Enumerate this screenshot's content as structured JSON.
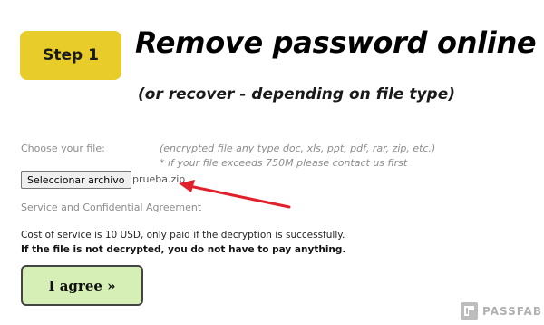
{
  "step": {
    "label": "Step 1"
  },
  "header": {
    "title": "Remove password online",
    "subtitle": "(or recover - depending on file type)"
  },
  "file_section": {
    "choose_label": "Choose your file:",
    "hint_types": "(encrypted file any type doc, xls, ppt, pdf, rar, zip, etc.)",
    "hint_size": "* if your file exceeds 750M please contact us first",
    "select_button_label": "Seleccionar archivo",
    "selected_file_name": "prueba.zip"
  },
  "agreement": {
    "link_text": "Service and Confidential Agreement",
    "cost_text": "Cost of service is 10 USD, only paid if the decryption is successfully.",
    "no_pay_text": "If the file is not decrypted, you do not have to pay anything.",
    "agree_button_label": "I agree »"
  },
  "watermark": {
    "brand": "PASSFAB",
    "logo_icon": "passfab-logo-icon"
  },
  "colors": {
    "step_badge": "#e8cc2a",
    "agree_button": "#d6efb6",
    "arrow": "#e0212b",
    "muted_text": "#8c8c8c"
  }
}
